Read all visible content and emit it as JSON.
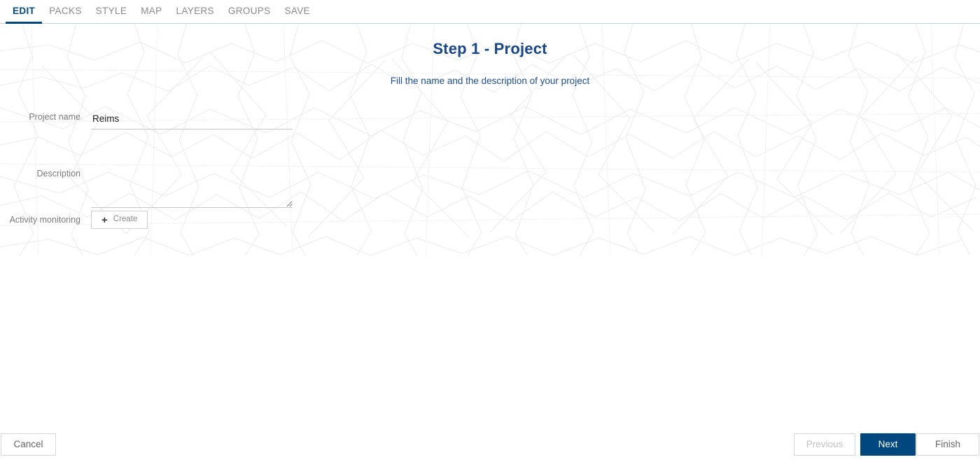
{
  "tabbar": {
    "tabs": [
      {
        "label": "EDIT",
        "active": true
      },
      {
        "label": "PACKS",
        "active": false
      },
      {
        "label": "STYLE",
        "active": false
      },
      {
        "label": "MAP",
        "active": false
      },
      {
        "label": "LAYERS",
        "active": false
      },
      {
        "label": "GROUPS",
        "active": false
      },
      {
        "label": "SAVE",
        "active": false
      }
    ]
  },
  "wizard": {
    "title": "Step 1 - Project",
    "subtitle": "Fill the name and the description of your project"
  },
  "form": {
    "project_name": {
      "label": "Project name",
      "value": "Reims",
      "placeholder": ""
    },
    "description": {
      "label": "Description",
      "value": "",
      "placeholder": ""
    },
    "activity_monitoring": {
      "label": "Activity monitoring",
      "create_button": "Create",
      "plus_icon": "plus-icon"
    }
  },
  "footer": {
    "cancel": "Cancel",
    "previous": "Previous",
    "next": "Next",
    "finish": "Finish"
  },
  "colors": {
    "accent": "#00467F",
    "title": "#18468a",
    "subtitle": "#1b4f8f",
    "label": "#7b7b7b",
    "tab_inactive": "#8a8a8a",
    "border": "#d6d6d6",
    "map_watermark": "#ededed"
  }
}
